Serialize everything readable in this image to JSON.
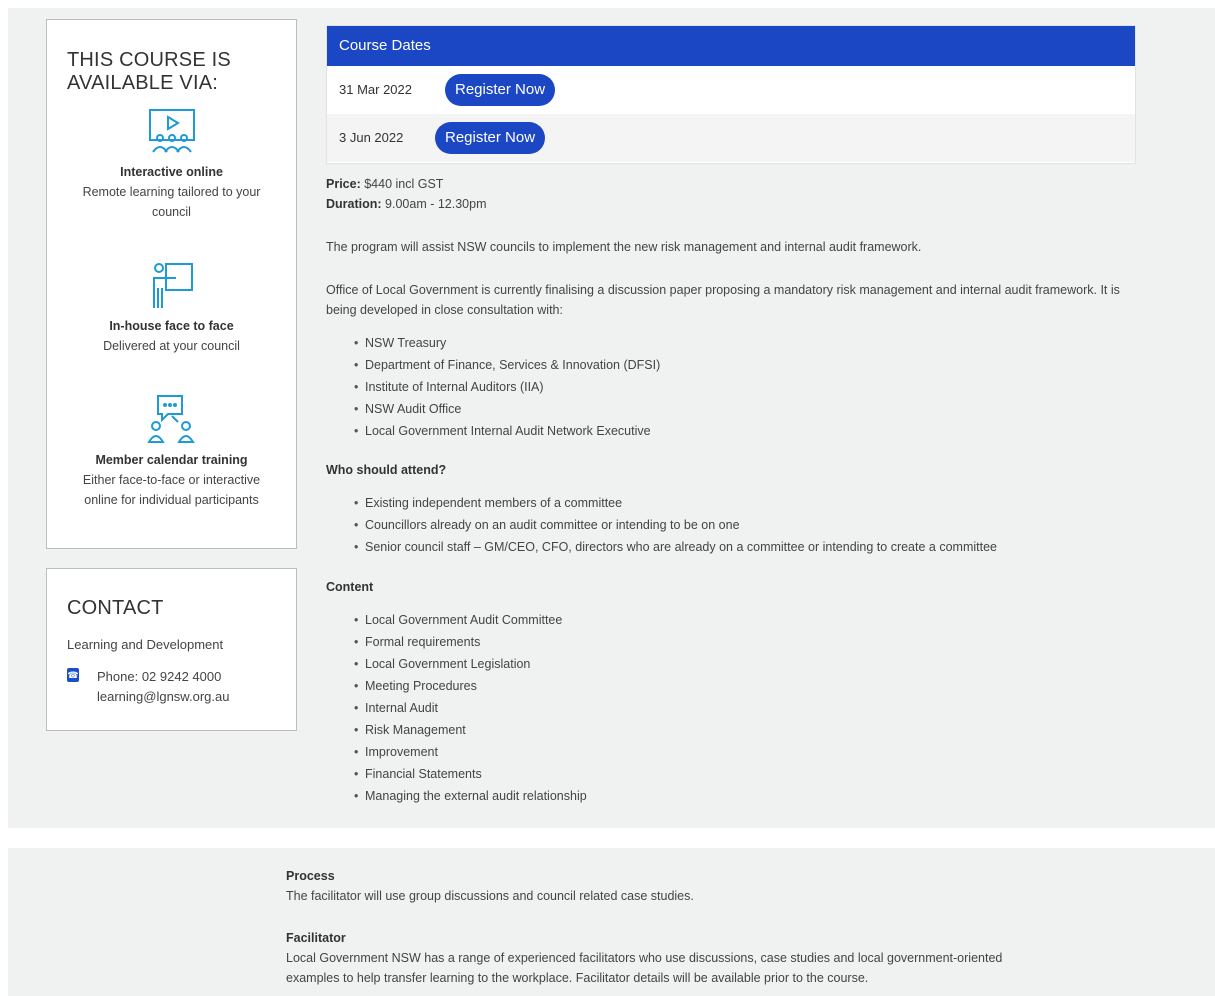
{
  "available": {
    "title_line1": "THIS COURSE IS",
    "title_line2": "AVAILABLE VIA:",
    "modes": [
      {
        "title": "Interactive online",
        "desc": "Remote learning tailored to your council"
      },
      {
        "title": "In-house face to face",
        "desc": "Delivered at your council"
      },
      {
        "title": "Member calendar training",
        "desc": "Either face-to-face or interactive online for individual participants"
      }
    ]
  },
  "contact": {
    "title": "CONTACT",
    "dept": "Learning and Development",
    "phone": "Phone: 02 9242 4000",
    "email": "learning@lgnsw.org.au"
  },
  "dates": {
    "heading": "Course Dates",
    "rows": [
      {
        "date": "31 Mar 2022",
        "button": "Register Now"
      },
      {
        "date": "3 Jun 2022",
        "button": "Register Now"
      }
    ]
  },
  "details": {
    "price_label": "Price:",
    "price_value": " $440 incl GST",
    "duration_label": "Duration:",
    "duration_value": " 9.00am - 12.30pm",
    "intro": "The program will assist NSW councils to implement the new risk management and internal audit framework.",
    "olg_para": "Office of Local Government is currently finalising a discussion paper proposing a mandatory risk management and internal audit framework.  It is being developed in close consultation with:",
    "consultation": [
      "NSW Treasury",
      "Department of Finance, Services & Innovation (DFSI)",
      "Institute of Internal Auditors (IIA)",
      "NSW Audit Office",
      "Local Government Internal Audit Network Executive"
    ],
    "who_heading": "Who should attend?",
    "who": [
      "Existing independent members of a committee",
      "Councillors already on an audit committee or intending to be on one",
      "Senior council staff – GM/CEO, CFO, directors who are already on a committee or intending to create a committee"
    ],
    "content_heading": "Content",
    "content": [
      "Local Government Audit Committee",
      "Formal requirements",
      "Local Government Legislation",
      "Meeting Procedures",
      "Internal Audit",
      "Risk Management",
      "Improvement",
      "Financial Statements",
      "Managing the external audit relationship"
    ]
  },
  "bottom": {
    "process_heading": "Process",
    "process_text": "The facilitator will use group discussions and council related case studies.",
    "facilitator_heading": "Facilitator",
    "facilitator_line1": "Local Government NSW has a range of experienced facilitators who use discussions, case studies and local government-oriented",
    "facilitator_line2": "examples to help transfer learning to the workplace. Facilitator details will be available prior to the course."
  },
  "colors": {
    "accent": "#1b47c4",
    "icon": "#1e9ad6"
  }
}
